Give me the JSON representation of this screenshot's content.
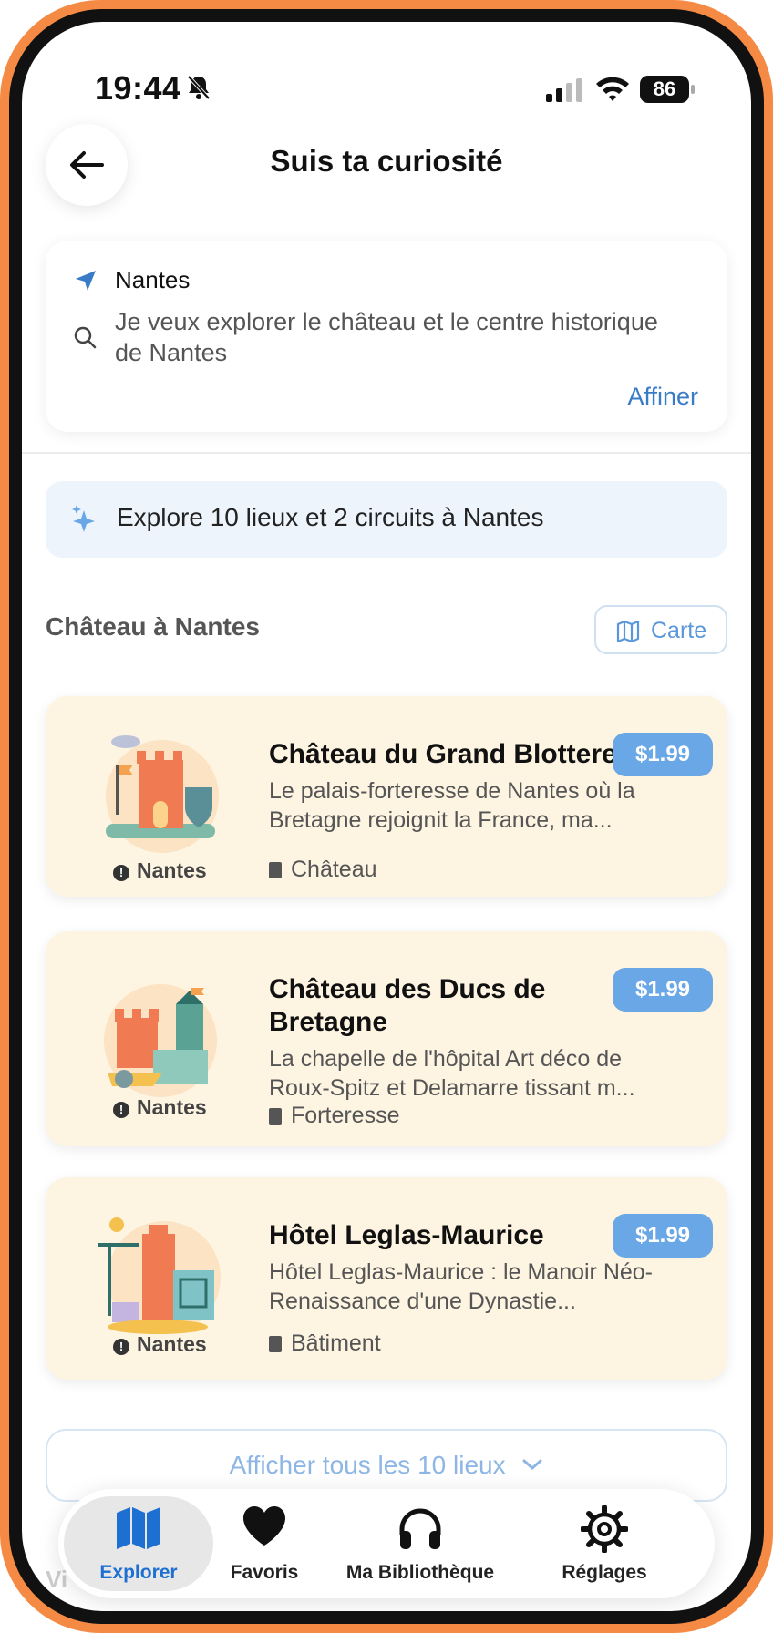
{
  "status_bar": {
    "time": "19:44",
    "battery": "86"
  },
  "header": {
    "title": "Suis ta curiosité"
  },
  "search": {
    "location": "Nantes",
    "query": "Je veux explorer le château et le centre historique de Nantes",
    "refine_label": "Affiner"
  },
  "banner": {
    "text": "Explore 10 lieux et 2 circuits à Nantes"
  },
  "section": {
    "title": "Château à Nantes",
    "map_button": "Carte"
  },
  "places": [
    {
      "title": "Château du Grand Blottereau",
      "description": "Le palais-forteresse de Nantes où la Bretagne rejoignit la France, ma...",
      "city": "Nantes",
      "category": "Château",
      "price": "$1.99"
    },
    {
      "title": "Château des Ducs de Bretagne",
      "description": "La chapelle de l'hôpital Art déco de Roux-Spitz et Delamarre tissant m...",
      "city": "Nantes",
      "category": "Forteresse",
      "price": "$1.99"
    },
    {
      "title": "Hôtel Leglas-Maurice",
      "description": "Hôtel Leglas-Maurice : le Manoir Néo-Renaissance d'une Dynastie...",
      "city": "Nantes",
      "category": "Bâtiment",
      "price": "$1.99"
    }
  ],
  "show_all": {
    "label": "Afficher tous les 10 lieux"
  },
  "tabbar": {
    "items": [
      {
        "label": "Explorer",
        "icon": "map-icon",
        "active": true
      },
      {
        "label": "Favoris",
        "icon": "heart-icon"
      },
      {
        "label": "Ma Bibliothèque",
        "icon": "headphones-icon"
      },
      {
        "label": "Réglages",
        "icon": "gear-icon"
      }
    ]
  },
  "colors": {
    "accent": "#3a7bc8",
    "price_badge": "#6aa7e6",
    "card_bg": "#fdf4e2",
    "banner_bg": "#eef4fc",
    "frame": "#f58a45"
  }
}
